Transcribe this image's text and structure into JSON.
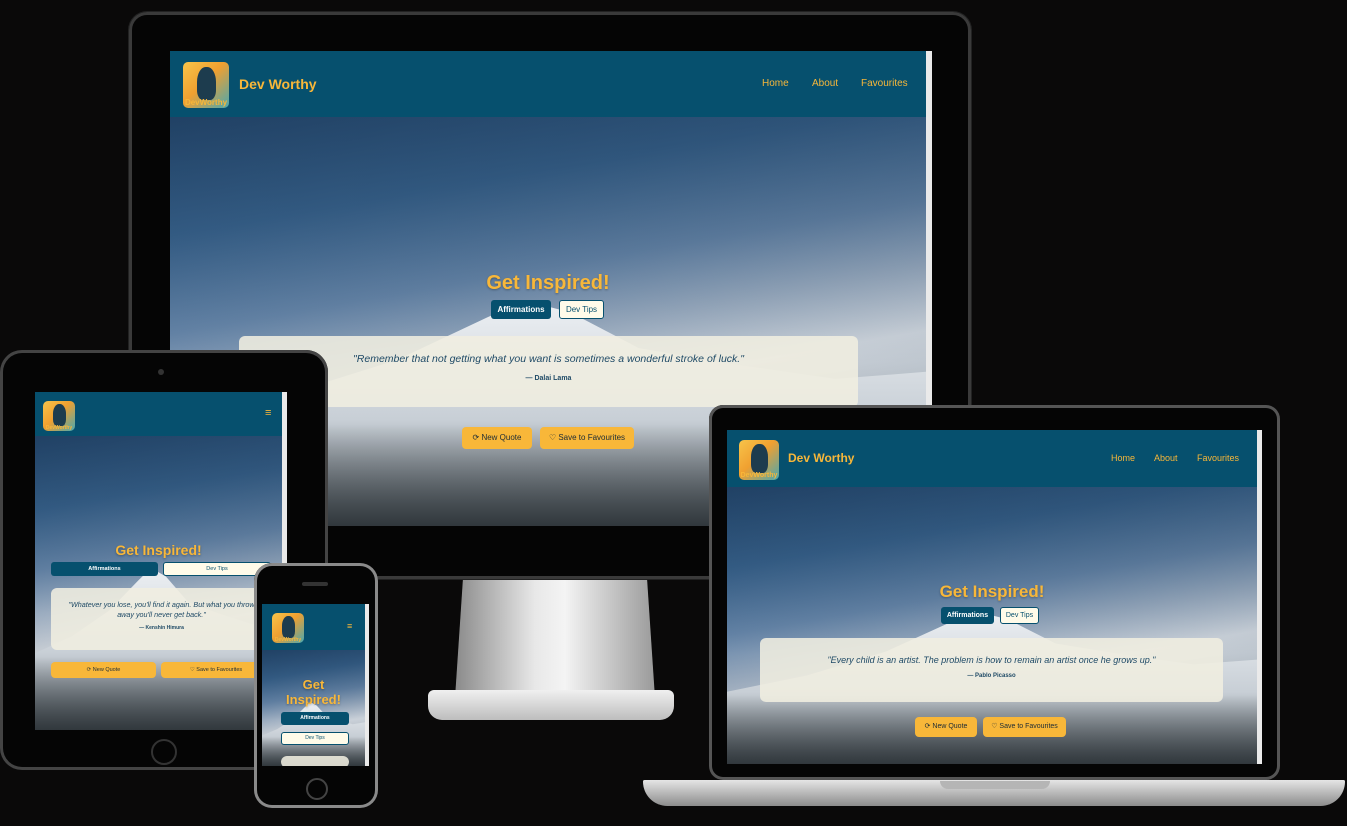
{
  "site": {
    "brand": "Dev Worthy",
    "logo_text": "DevWorthy",
    "colors": {
      "navbar": "#06506e",
      "accent": "#f8b739",
      "card": "#f0eee0",
      "page_bg": "#0a0909"
    }
  },
  "nav": {
    "home": "Home",
    "about": "About",
    "favourites": "Favourites",
    "menu_icon": "≡"
  },
  "hero": {
    "title": "Get Inspired!",
    "title_line1": "Get",
    "title_line2": "Inspired!",
    "tab_affirmations": "Affirmations",
    "tab_dev_tips": "Dev Tips",
    "btn_new_quote": "⟳ New Quote",
    "btn_save": "♡ Save to Favourites"
  },
  "quotes": {
    "desktop": {
      "text": "\"Remember that not getting what you want is sometimes a wonderful stroke of luck.\"",
      "author": "— Dalai Lama"
    },
    "tablet": {
      "text": "\"Whatever you lose, you'll find it again. But what you throw away you'll never get back.\"",
      "author": "— Kenshin Himura"
    },
    "laptop": {
      "text": "\"Every child is an artist. The problem is how to remain an artist once he grows up.\"",
      "author": "— Pablo Picasso"
    }
  }
}
